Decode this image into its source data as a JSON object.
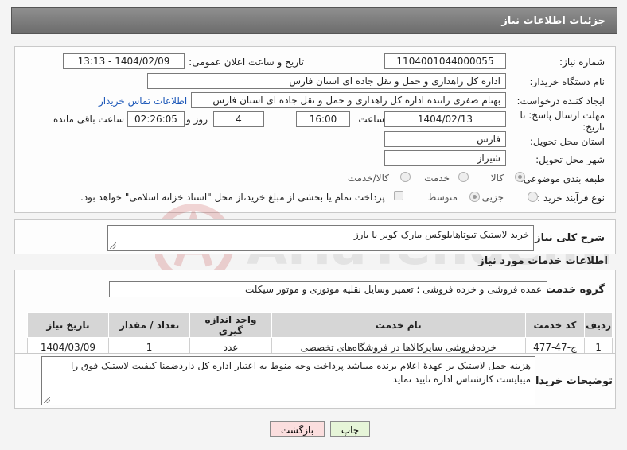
{
  "header": {
    "title": "جزئیات اطلاعات نیاز"
  },
  "form": {
    "need_number_label": "شماره نیاز:",
    "need_number": "1104001044000055",
    "announce_label": "تاریخ و ساعت اعلان عمومی:",
    "announce_value": "1404/02/09 - 13:13",
    "buyer_org_label": "نام دستگاه خریدار:",
    "buyer_org": "اداره کل راهداری و حمل و نقل جاده ای استان فارس",
    "requester_label": "ایجاد کننده درخواست:",
    "requester": "بهنام صفری راننده اداره کل راهداری و حمل و نقل جاده ای استان فارس",
    "contact_link": "اطلاعات تماس خریدار",
    "deadline_label_1": "مهلت ارسال پاسخ: تا",
    "deadline_label_2": "تاریخ:",
    "deadline_date": "1404/02/13",
    "time_label": "ساعت",
    "deadline_time": "16:00",
    "days": "4",
    "days_label": "روز و",
    "remaining": "02:26:05",
    "remaining_label": "ساعت باقی مانده",
    "province_label": "استان محل تحویل:",
    "province": "فارس",
    "city_label": "شهر محل تحویل:",
    "city": "شیراز",
    "category_label": "طبقه بندی موضوعی:",
    "category_options": [
      "کالا",
      "خدمت",
      "کالا/خدمت"
    ],
    "category_selected": "کالا",
    "process_label": "نوع فرآیند خرید :",
    "process_options": [
      "جزیی",
      "متوسط"
    ],
    "process_selected": "متوسط",
    "payment_note": "پرداخت تمام یا بخشی از مبلغ خرید،از محل \"اسناد خزانه اسلامی\" خواهد بود."
  },
  "summary": {
    "label": "شرح کلی نیاز:",
    "text": "خرید لاستیک تیوتاهایلوکس مارک کویر یا بارز"
  },
  "services": {
    "section_title": "اطلاعات خدمات مورد نیاز",
    "group_label": "گروه خدمت:",
    "group_value": "عمده فروشی و خرده فروشی ؛ تعمیر وسایل نقلیه موتوری و موتور سیکلت"
  },
  "table": {
    "headers": [
      "ردیف",
      "کد خدمت",
      "نام خدمت",
      "واحد اندازه گیری",
      "تعداد / مقدار",
      "تاریخ نیاز"
    ],
    "rows": [
      [
        "1",
        "ج-47-477",
        "خرده‌فروشی سایرکالاها در فروشگاه‌های تخصصی",
        "عدد",
        "1",
        "1404/03/09"
      ]
    ]
  },
  "buyer_notes": {
    "label": "توضیحات خریدار:",
    "text": "هزینه حمل لاستیک بر عهدهٔ اعلام برنده میباشد پرداخت وجه منوط به اعتبار اداره کل داردضمنا کیفیت لاستیک فوق را میبایست کارشناس اداره تایید نماید"
  },
  "buttons": {
    "print": "چاپ",
    "back": "بازگشت"
  },
  "watermark": {
    "text": "AriaTender.net"
  },
  "colors": {
    "title_bar": "#7a7a7a",
    "link": "#1a56b8",
    "back_button": "#fbdede",
    "print_button": "#e6f5d8"
  }
}
